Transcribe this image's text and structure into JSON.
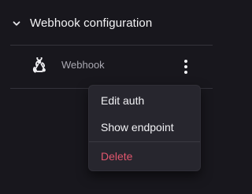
{
  "section": {
    "title": "Webhook configuration",
    "expand_icon": "chevron-down-icon"
  },
  "webhook": {
    "icon": "webhook-icon",
    "label": "Webhook",
    "menu_icon": "kebab-menu-icon"
  },
  "menu": {
    "items": [
      {
        "label": "Edit auth"
      },
      {
        "label": "Show endpoint"
      },
      {
        "label": "Delete"
      }
    ]
  },
  "colors": {
    "background": "#18171d",
    "menu_background": "#27262e",
    "danger": "#e0566d",
    "muted_text": "#a9a8b1"
  }
}
